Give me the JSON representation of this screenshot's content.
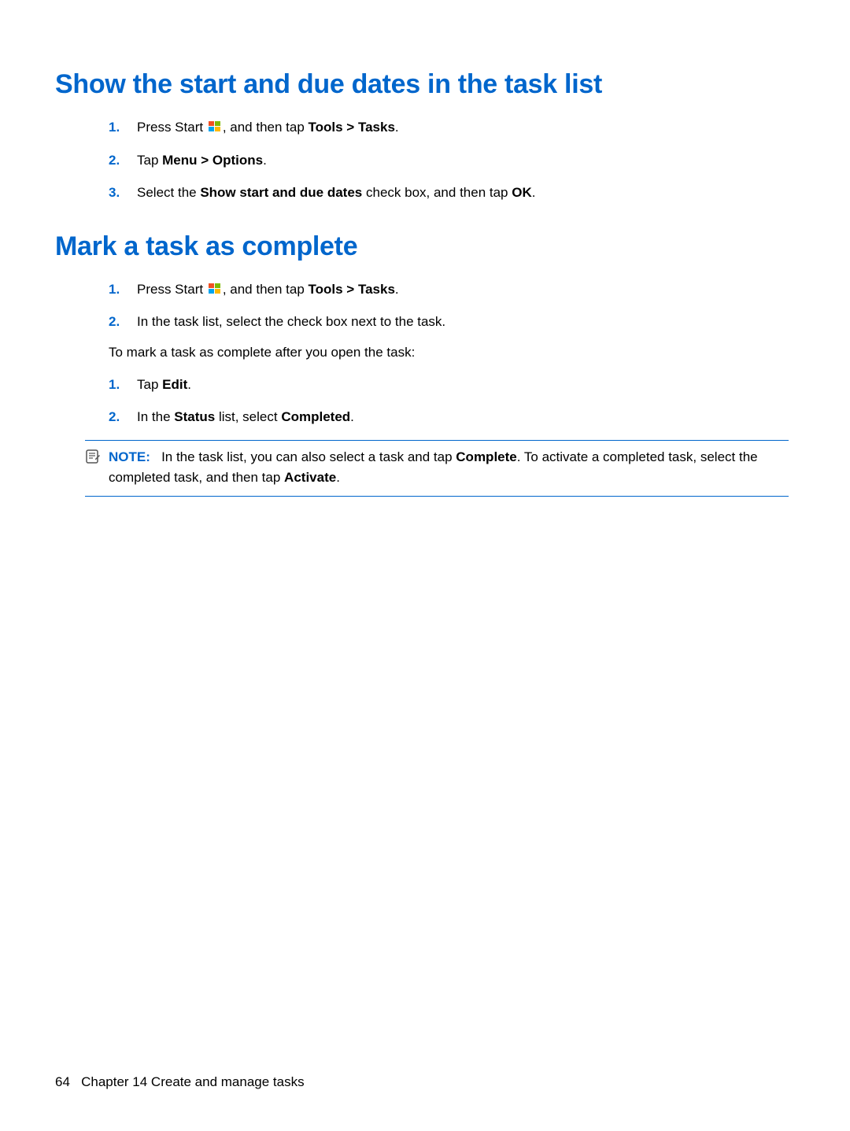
{
  "section1": {
    "title": "Show the start and due dates in the task list",
    "steps": [
      {
        "num": "1.",
        "pre": "Press Start ",
        "post": ", and then tap ",
        "bold1": "Tools > Tasks",
        "tail": "."
      },
      {
        "num": "2.",
        "pre": "Tap ",
        "bold1": "Menu > Options",
        "tail": "."
      },
      {
        "num": "3.",
        "pre": "Select the ",
        "bold1": "Show start and due dates",
        "mid": " check box, and then tap ",
        "bold2": "OK",
        "tail": "."
      }
    ]
  },
  "section2": {
    "title": "Mark a task as complete",
    "stepsA": [
      {
        "num": "1.",
        "pre": "Press Start ",
        "post": ", and then tap ",
        "bold1": "Tools > Tasks",
        "tail": "."
      },
      {
        "num": "2.",
        "pre": "In the task list, select the check box next to the task.",
        "bold1": "",
        "tail": ""
      }
    ],
    "para": "To mark a task as complete after you open the task:",
    "stepsB": [
      {
        "num": "1.",
        "pre": "Tap ",
        "bold1": "Edit",
        "tail": "."
      },
      {
        "num": "2.",
        "pre": "In the ",
        "bold1": "Status",
        "mid": " list, select ",
        "bold2": "Completed",
        "tail": "."
      }
    ],
    "note": {
      "label": "NOTE:",
      "t1": "In the task list, you can also select a task and tap ",
      "b1": "Complete",
      "t2": ". To activate a completed task, select the completed task, and then tap ",
      "b2": "Activate",
      "t3": "."
    }
  },
  "footer": {
    "page": "64",
    "chapter": "Chapter 14   Create and manage tasks"
  }
}
